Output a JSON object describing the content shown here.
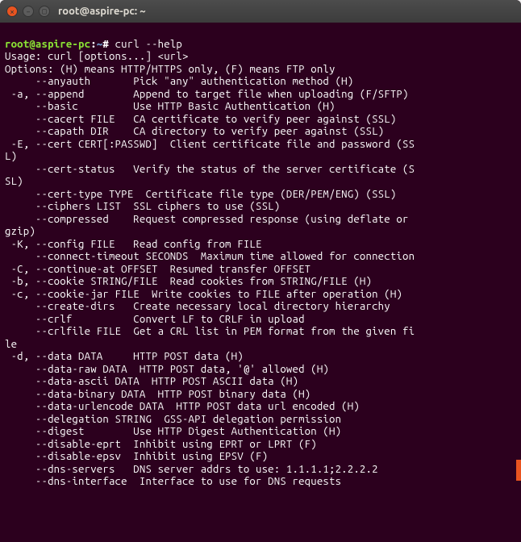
{
  "titlebar": {
    "title": "root@aspire-pc: ~"
  },
  "window_controls": {
    "close": "×",
    "minimize": "–",
    "maximize": "▢"
  },
  "prompt": {
    "user_host": "root@aspire-pc",
    "separator1": ":",
    "path": "~",
    "separator2": "#"
  },
  "command": "curl --help",
  "output": [
    "Usage: curl [options...] <url>",
    "Options: (H) means HTTP/HTTPS only, (F) means FTP only",
    "     --anyauth       Pick \"any\" authentication method (H)",
    " -a, --append        Append to target file when uploading (F/SFTP)",
    "     --basic         Use HTTP Basic Authentication (H)",
    "     --cacert FILE   CA certificate to verify peer against (SSL)",
    "     --capath DIR    CA directory to verify peer against (SSL)",
    " -E, --cert CERT[:PASSWD]  Client certificate file and password (SS",
    "L)",
    "     --cert-status   Verify the status of the server certificate (S",
    "SL)",
    "     --cert-type TYPE  Certificate file type (DER/PEM/ENG) (SSL)",
    "     --ciphers LIST  SSL ciphers to use (SSL)",
    "     --compressed    Request compressed response (using deflate or ",
    "gzip)",
    " -K, --config FILE   Read config from FILE",
    "     --connect-timeout SECONDS  Maximum time allowed for connection",
    " -C, --continue-at OFFSET  Resumed transfer OFFSET",
    " -b, --cookie STRING/FILE  Read cookies from STRING/FILE (H)",
    " -c, --cookie-jar FILE  Write cookies to FILE after operation (H)",
    "     --create-dirs   Create necessary local directory hierarchy",
    "     --crlf          Convert LF to CRLF in upload",
    "     --crlfile FILE  Get a CRL list in PEM format from the given fi",
    "le",
    " -d, --data DATA     HTTP POST data (H)",
    "     --data-raw DATA  HTTP POST data, '@' allowed (H)",
    "     --data-ascii DATA  HTTP POST ASCII data (H)",
    "     --data-binary DATA  HTTP POST binary data (H)",
    "     --data-urlencode DATA  HTTP POST data url encoded (H)",
    "     --delegation STRING  GSS-API delegation permission",
    "     --digest        Use HTTP Digest Authentication (H)",
    "     --disable-eprt  Inhibit using EPRT or LPRT (F)",
    "     --disable-epsv  Inhibit using EPSV (F)",
    "     --dns-servers   DNS server addrs to use: 1.1.1.1;2.2.2.2",
    "     --dns-interface  Interface to use for DNS requests"
  ]
}
